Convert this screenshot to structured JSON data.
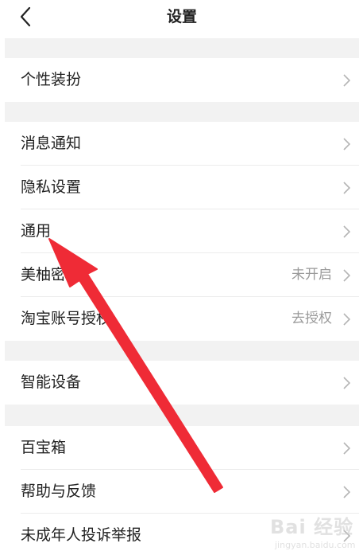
{
  "header": {
    "title": "设置",
    "back_icon": "chevron-left-icon"
  },
  "sections": [
    {
      "rows": [
        {
          "label": "个性装扮",
          "value": ""
        }
      ]
    },
    {
      "rows": [
        {
          "label": "消息通知",
          "value": ""
        },
        {
          "label": "隐私设置",
          "value": ""
        },
        {
          "label": "通用",
          "value": ""
        },
        {
          "label": "美柚密码",
          "value": "未开启"
        },
        {
          "label": "淘宝账号授权",
          "value": "去授权"
        }
      ]
    },
    {
      "rows": [
        {
          "label": "智能设备",
          "value": ""
        }
      ]
    },
    {
      "rows": [
        {
          "label": "百宝箱",
          "value": ""
        },
        {
          "label": "帮助与反馈",
          "value": ""
        },
        {
          "label": "未成年人投诉举报",
          "value": ""
        }
      ]
    }
  ],
  "colors": {
    "separator_band": "#f2f2f2",
    "text": "#222222",
    "value_text": "#9a9a9a",
    "chevron": "#b5b5b5",
    "annotation_arrow": "#ef2b36"
  },
  "watermark": {
    "text": "Bai 经验",
    "sub": "jingyan.baidu.com"
  }
}
